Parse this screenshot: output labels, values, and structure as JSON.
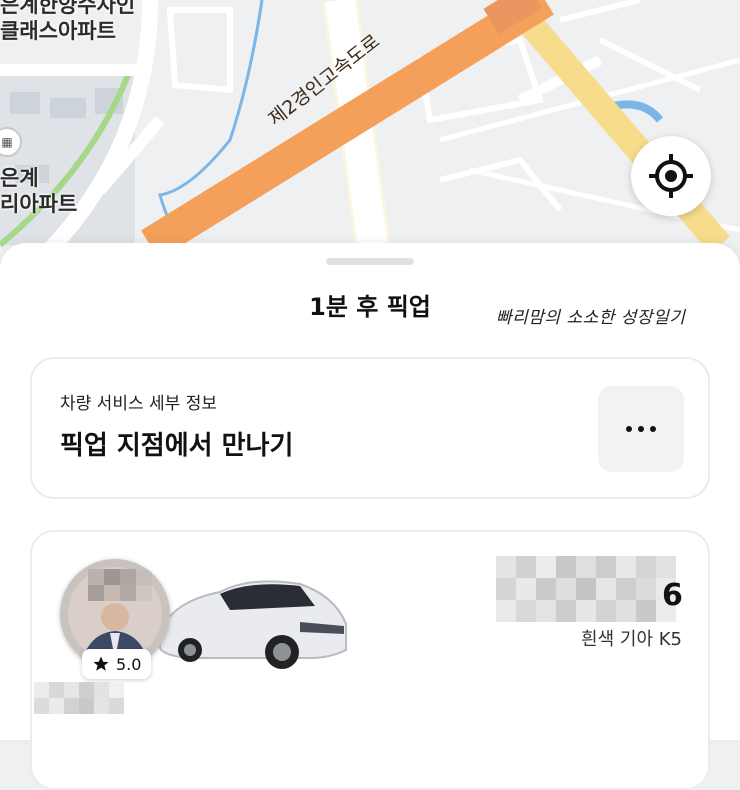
{
  "map": {
    "labels": {
      "apt_top_line1": "은계한양수자인",
      "apt_top_line2": "클래스아파트",
      "apt_mid_line1": "은계",
      "apt_mid_line2": "리아파트",
      "road_name": "제2경인고속도로"
    },
    "locate_icon": "crosshair-icon",
    "colors": {
      "background": "#eef0f2",
      "expressway": "#f5a05a",
      "main_road": "#f7dc8b",
      "water": "#7bb6e8",
      "park": "#a7d88a"
    }
  },
  "sheet": {
    "title": "1분 후 픽업",
    "watermark": "빠리맘의 소소한 성장일기"
  },
  "service_card": {
    "subtitle": "차량 서비스 세부 정보",
    "title": "픽업 지점에서 만나기",
    "more_icon": "more-horizontal-icon"
  },
  "driver_card": {
    "rating": "5.0",
    "rating_icon": "star-icon",
    "plate_visible_tail": "6",
    "car_description": "흰색 기아 K5"
  }
}
